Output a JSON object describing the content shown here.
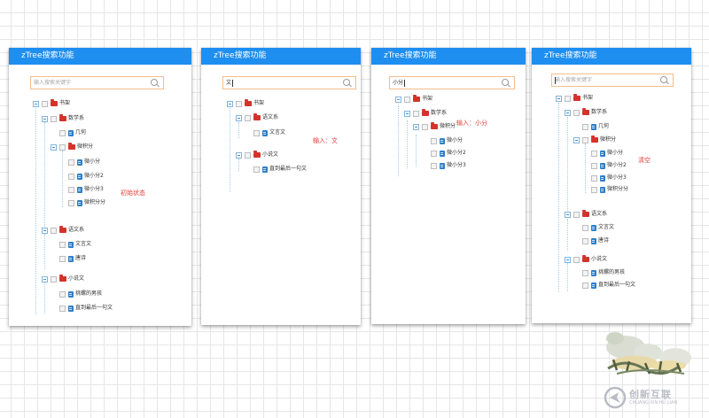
{
  "panels": [
    {
      "title": "zTree搜索功能",
      "search": {
        "value": "",
        "placeholder": "输入搜索关键字"
      },
      "nodes": [
        {
          "label": "书架",
          "icon": "folder"
        },
        {
          "label": "数学系",
          "icon": "folder"
        },
        {
          "label": "几何",
          "icon": "file"
        },
        {
          "label": "微积分",
          "icon": "folder"
        },
        {
          "label": "微小分",
          "icon": "file"
        },
        {
          "label": "微小分2",
          "icon": "file"
        },
        {
          "label": "微小分3",
          "icon": "file"
        },
        {
          "label": "微积分分",
          "icon": "file"
        },
        {
          "label": "语文系",
          "icon": "folder"
        },
        {
          "label": "文言文",
          "icon": "file"
        },
        {
          "label": "唐诗",
          "icon": "file"
        },
        {
          "label": "小说文",
          "icon": "folder"
        },
        {
          "label": "挑螺的男孩",
          "icon": "file"
        },
        {
          "label": "直到最后一句文",
          "icon": "file"
        }
      ],
      "annotation": "初始状态"
    },
    {
      "title": "zTree搜索功能",
      "search": {
        "value": "文",
        "placeholder": ""
      },
      "nodes": [
        {
          "label": "书架",
          "icon": "folder"
        },
        {
          "label": "语文系",
          "icon": "folder"
        },
        {
          "label": "文言文",
          "icon": "file"
        },
        {
          "label": "小说文",
          "icon": "folder"
        },
        {
          "label": "直到最后一句文",
          "icon": "file"
        }
      ],
      "annotation": "输入：文"
    },
    {
      "title": "zTree搜索功能",
      "search": {
        "value": "小分",
        "placeholder": ""
      },
      "nodes": [
        {
          "label": "书架",
          "icon": "folder"
        },
        {
          "label": "数学系",
          "icon": "folder"
        },
        {
          "label": "微积分",
          "icon": "folder"
        },
        {
          "label": "微小分",
          "icon": "file"
        },
        {
          "label": "微小分2",
          "icon": "file"
        },
        {
          "label": "微小分3",
          "icon": "file"
        }
      ],
      "annotation": "输入：小分"
    },
    {
      "title": "zTree搜索功能",
      "search": {
        "value": "",
        "placeholder": "输入搜索关键字"
      },
      "nodes": [
        {
          "label": "书架",
          "icon": "folder"
        },
        {
          "label": "数学系",
          "icon": "folder"
        },
        {
          "label": "几何",
          "icon": "file"
        },
        {
          "label": "微积分",
          "icon": "folder"
        },
        {
          "label": "微小分",
          "icon": "file"
        },
        {
          "label": "微小分2",
          "icon": "file"
        },
        {
          "label": "微小分3",
          "icon": "file"
        },
        {
          "label": "微积分分",
          "icon": "file"
        },
        {
          "label": "语文系",
          "icon": "folder"
        },
        {
          "label": "文言文",
          "icon": "file"
        },
        {
          "label": "唐诗",
          "icon": "file"
        },
        {
          "label": "小说文",
          "icon": "folder"
        },
        {
          "label": "挑螺的男孩",
          "icon": "file"
        },
        {
          "label": "直到最后一句文",
          "icon": "file"
        }
      ],
      "annotation": "清空"
    }
  ],
  "watermark": {
    "logo_text": "创新互联",
    "logo_subtext": "CHUANG XIN HU LIAN"
  },
  "colors": {
    "header": "#1e8ef0",
    "search_border": "#f3bd8a",
    "annotation": "#e0403a",
    "folder": "#d3332b",
    "file": "#2f7fc7"
  }
}
